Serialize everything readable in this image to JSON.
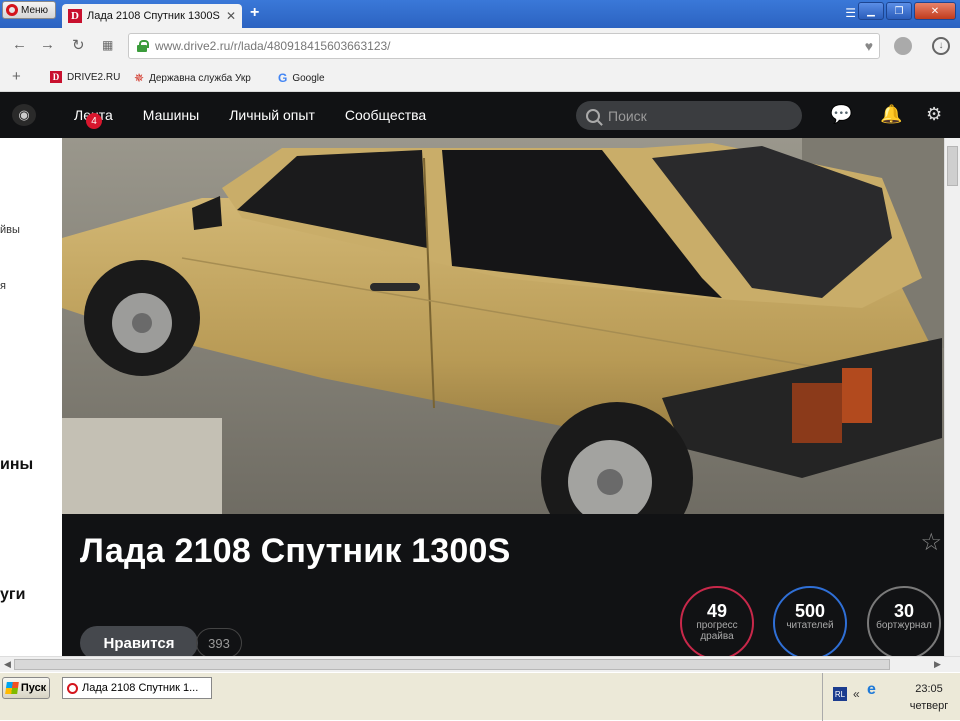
{
  "browser": {
    "menu_label": "Меню",
    "tab_title": "Лада 2108 Спутник 1300S",
    "url": "www.drive2.ru/r/lada/4809184156036631​23/",
    "bookmarks": [
      {
        "label": "DRIVE2.RU"
      },
      {
        "label": "Державна служба Укр"
      },
      {
        "label": "Google"
      }
    ]
  },
  "site": {
    "nav": [
      {
        "label": "Лента",
        "badge": "4"
      },
      {
        "label": "Машины"
      },
      {
        "label": "Личный опыт"
      },
      {
        "label": "Сообщества"
      }
    ],
    "search_placeholder": "Поиск",
    "left_fragments": [
      "йвы",
      "я",
      "ины",
      "уги"
    ]
  },
  "car": {
    "title": "Лада 2108 Спутник 1300S",
    "like_label": "Нравится",
    "like_count": "393",
    "stats": [
      {
        "value": "49",
        "label_line1": "прогресс",
        "label_line2": "драйва",
        "color": "#c8284a"
      },
      {
        "value": "500",
        "label_line1": "читателей",
        "label_line2": "",
        "color": "#2f6fd6"
      },
      {
        "value": "30",
        "label_line1": "бортжурнал",
        "label_line2": "",
        "color": "#7a7a7a"
      }
    ]
  },
  "taskbar": {
    "start_label": "Пуск",
    "task_label": "Лада 2108 Спутник 1...",
    "lang": "RL",
    "time": "23:05",
    "day": "четверг"
  }
}
